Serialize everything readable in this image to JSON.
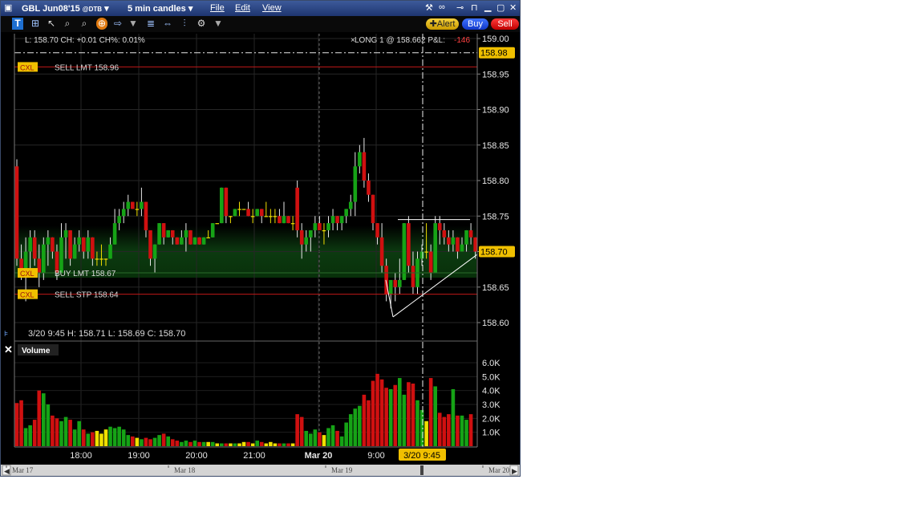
{
  "window": {
    "symbol": "GBL Jun08'15",
    "exchange": "@DTB",
    "interval": "5 min candles",
    "menu": [
      "File",
      "Edit",
      "View"
    ],
    "buttons": {
      "alert": "Alert",
      "buy": "Buy",
      "sell": "Sell"
    }
  },
  "colors": {
    "up": "#16a316",
    "down": "#d01010",
    "neutral": "#f0e000",
    "order_line": "#c01818",
    "label_bg": "#f0c000"
  },
  "info": {
    "last_line": "L: 158.70 CH: +0.01 CH%: 0.01%",
    "position": "LONG 1 @ 158.662 P&L:",
    "pnl": "-146",
    "bar_line": "3/20 9:45    H: 158.71    L: 158.69    C: 158.70"
  },
  "orders": [
    {
      "tag": "CXL",
      "label": "SELL LMT 158.96",
      "price": 158.96
    },
    {
      "tag": "CXL",
      "label": "BUY LMT 158.67",
      "price": 158.67
    },
    {
      "tag": "CXL",
      "label": "SELL STP 158.64",
      "price": 158.64
    }
  ],
  "price_axis": {
    "ticks": [
      "159.00",
      "158.95",
      "158.90",
      "158.85",
      "158.80",
      "158.75",
      "158.70",
      "158.65",
      "158.60"
    ],
    "alert_price": "158.98",
    "last_price": "158.70"
  },
  "volume_panel": {
    "title": "Volume",
    "ticks": [
      "6.0K",
      "5.0K",
      "4.0K",
      "3.0K",
      "2.0K",
      "1.0K"
    ]
  },
  "time_axis": {
    "labels": [
      "18:00",
      "19:00",
      "20:00",
      "21:00",
      "Mar 20",
      "9:00"
    ],
    "cursor": "3/20 9:45"
  },
  "navigator": {
    "labels": [
      "Mar 17",
      "Mar 18",
      "Mar 19",
      "Mar 20"
    ]
  },
  "chart_data": {
    "type": "candlestick",
    "ylim": [
      158.59,
      159.01
    ],
    "volume_ylim": [
      0,
      6500
    ],
    "candles": [
      [
        158.82,
        158.83,
        158.68,
        158.69
      ],
      [
        158.69,
        158.71,
        158.66,
        158.67
      ],
      [
        158.67,
        158.72,
        158.63,
        158.7
      ],
      [
        158.7,
        158.73,
        158.67,
        158.72
      ],
      [
        158.72,
        158.73,
        158.68,
        158.69
      ],
      [
        158.69,
        158.71,
        158.65,
        158.67
      ],
      [
        158.67,
        158.72,
        158.66,
        158.71
      ],
      [
        158.71,
        158.73,
        158.68,
        158.72
      ],
      [
        158.72,
        158.72,
        158.69,
        158.7
      ],
      [
        158.7,
        158.71,
        158.66,
        158.67
      ],
      [
        158.67,
        158.74,
        158.67,
        158.72
      ],
      [
        158.72,
        158.74,
        158.69,
        158.73
      ],
      [
        158.73,
        158.73,
        158.68,
        158.69
      ],
      [
        158.69,
        158.72,
        158.69,
        158.71
      ],
      [
        158.71,
        158.73,
        158.7,
        158.72
      ],
      [
        158.72,
        158.72,
        158.69,
        158.7
      ],
      [
        158.7,
        158.73,
        158.69,
        158.72
      ],
      [
        158.72,
        158.72,
        158.68,
        158.69
      ],
      [
        158.69,
        158.7,
        158.68,
        158.69
      ],
      [
        158.69,
        158.71,
        158.68,
        158.69
      ],
      [
        158.69,
        158.69,
        158.68,
        158.69
      ],
      [
        158.69,
        158.72,
        158.69,
        158.71
      ],
      [
        158.71,
        158.76,
        158.71,
        158.74
      ],
      [
        158.74,
        158.76,
        158.73,
        158.75
      ],
      [
        158.75,
        158.77,
        158.74,
        158.76
      ],
      [
        158.76,
        158.78,
        158.75,
        158.77
      ],
      [
        158.77,
        158.77,
        158.76,
        158.76
      ],
      [
        158.76,
        158.77,
        158.75,
        158.76
      ],
      [
        158.76,
        158.79,
        158.75,
        158.77
      ],
      [
        158.77,
        158.77,
        158.72,
        158.73
      ],
      [
        158.73,
        158.73,
        158.68,
        158.69
      ],
      [
        158.69,
        158.71,
        158.67,
        158.71
      ],
      [
        158.71,
        158.74,
        158.71,
        158.74
      ],
      [
        158.74,
        158.74,
        158.71,
        158.72
      ],
      [
        158.72,
        158.73,
        158.72,
        158.73
      ],
      [
        158.73,
        158.73,
        158.71,
        158.72
      ],
      [
        158.72,
        158.72,
        158.71,
        158.71
      ],
      [
        158.71,
        158.73,
        158.71,
        158.72
      ],
      [
        158.72,
        158.74,
        158.7,
        158.73
      ],
      [
        158.73,
        158.73,
        158.71,
        158.71
      ],
      [
        158.71,
        158.72,
        158.71,
        158.72
      ],
      [
        158.72,
        158.72,
        158.71,
        158.71
      ],
      [
        158.71,
        158.72,
        158.71,
        158.72
      ],
      [
        158.72,
        158.73,
        158.72,
        158.72
      ],
      [
        158.72,
        158.74,
        158.72,
        158.74
      ],
      [
        158.74,
        158.74,
        158.74,
        158.74
      ],
      [
        158.74,
        158.79,
        158.74,
        158.79
      ],
      [
        158.79,
        158.79,
        158.74,
        158.75
      ],
      [
        158.75,
        158.75,
        158.74,
        158.75
      ],
      [
        158.75,
        158.76,
        158.75,
        158.76
      ],
      [
        158.76,
        158.77,
        158.75,
        158.76
      ],
      [
        158.76,
        158.76,
        158.76,
        158.76
      ],
      [
        158.76,
        158.77,
        158.75,
        158.75
      ],
      [
        158.75,
        158.76,
        158.74,
        158.75
      ],
      [
        158.75,
        158.76,
        158.75,
        158.76
      ],
      [
        158.76,
        158.76,
        158.74,
        158.75
      ],
      [
        158.75,
        158.77,
        158.75,
        158.75
      ],
      [
        158.75,
        158.76,
        158.74,
        158.75
      ],
      [
        158.75,
        158.76,
        158.74,
        158.75
      ],
      [
        158.75,
        158.76,
        158.74,
        158.74
      ],
      [
        158.74,
        158.77,
        158.74,
        158.75
      ],
      [
        158.75,
        158.75,
        158.74,
        158.74
      ],
      [
        158.74,
        158.75,
        158.73,
        158.74
      ],
      [
        158.79,
        158.8,
        158.72,
        158.73
      ],
      [
        158.73,
        158.74,
        158.69,
        158.71
      ],
      [
        158.71,
        158.73,
        158.7,
        158.72
      ],
      [
        158.72,
        158.73,
        158.7,
        158.73
      ],
      [
        158.73,
        158.75,
        158.72,
        158.74
      ],
      [
        158.74,
        158.75,
        158.73,
        158.73
      ],
      [
        158.73,
        158.74,
        158.71,
        158.73
      ],
      [
        158.73,
        158.75,
        158.72,
        158.74
      ],
      [
        158.74,
        158.76,
        158.73,
        158.75
      ],
      [
        158.75,
        158.75,
        158.73,
        158.74
      ],
      [
        158.74,
        158.75,
        158.73,
        158.75
      ],
      [
        158.75,
        158.76,
        158.74,
        158.76
      ],
      [
        158.76,
        158.78,
        158.75,
        158.77
      ],
      [
        158.77,
        158.84,
        158.75,
        158.82
      ],
      [
        158.82,
        158.85,
        158.81,
        158.84
      ],
      [
        158.84,
        158.86,
        158.79,
        158.8
      ],
      [
        158.8,
        158.81,
        158.77,
        158.78
      ],
      [
        158.78,
        158.78,
        158.73,
        158.74
      ],
      [
        158.74,
        158.74,
        158.71,
        158.72
      ],
      [
        158.72,
        158.74,
        158.67,
        158.68
      ],
      [
        158.68,
        158.69,
        158.63,
        158.64
      ],
      [
        158.64,
        158.65,
        158.62,
        158.66
      ],
      [
        158.66,
        158.67,
        158.63,
        158.65
      ],
      [
        158.65,
        158.69,
        158.64,
        158.66
      ],
      [
        158.66,
        158.74,
        158.66,
        158.74
      ],
      [
        158.74,
        158.75,
        158.67,
        158.68
      ],
      [
        158.68,
        158.7,
        158.64,
        158.65
      ],
      [
        158.65,
        158.7,
        158.64,
        158.69
      ],
      [
        158.69,
        158.71,
        158.68,
        158.7
      ],
      [
        158.7,
        158.74,
        158.69,
        158.7
      ],
      [
        158.7,
        158.71,
        158.66,
        158.67
      ],
      [
        158.67,
        158.75,
        158.67,
        158.74
      ],
      [
        158.74,
        158.75,
        158.71,
        158.73
      ],
      [
        158.73,
        158.74,
        158.71,
        158.72
      ],
      [
        158.72,
        158.73,
        158.7,
        158.71
      ],
      [
        158.71,
        158.73,
        158.7,
        158.72
      ],
      [
        158.72,
        158.72,
        158.69,
        158.7
      ],
      [
        158.7,
        158.72,
        158.7,
        158.71
      ],
      [
        158.71,
        158.73,
        158.7,
        158.73
      ],
      [
        158.73,
        158.74,
        158.71,
        158.72
      ],
      [
        158.72,
        158.72,
        158.69,
        158.7
      ]
    ],
    "volume": [
      3100,
      3300,
      1300,
      1500,
      1900,
      4000,
      3800,
      3000,
      2200,
      2000,
      1800,
      2100,
      1900,
      1200,
      1800,
      1200,
      900,
      1000,
      1100,
      900,
      1200,
      1400,
      1300,
      1400,
      1200,
      800,
      700,
      600,
      500,
      600,
      500,
      600,
      800,
      900,
      700,
      500,
      400,
      300,
      400,
      300,
      400,
      300,
      300,
      300,
      300,
      200,
      200,
      200,
      200,
      200,
      200,
      300,
      300,
      200,
      400,
      300,
      200,
      300,
      200,
      200,
      200,
      200,
      200,
      2300,
      2100,
      1100,
      900,
      1200,
      1000,
      800,
      1300,
      1500,
      1100,
      700,
      1700,
      2300,
      2700,
      2900,
      3700,
      3300,
      4700,
      5200,
      4800,
      4200,
      4100,
      4400,
      4900,
      3700,
      4600,
      4500,
      3300,
      2600,
      1800,
      4900,
      4300,
      2400,
      2100,
      2300,
      4100,
      2200,
      2200,
      1900,
      2300
    ]
  }
}
